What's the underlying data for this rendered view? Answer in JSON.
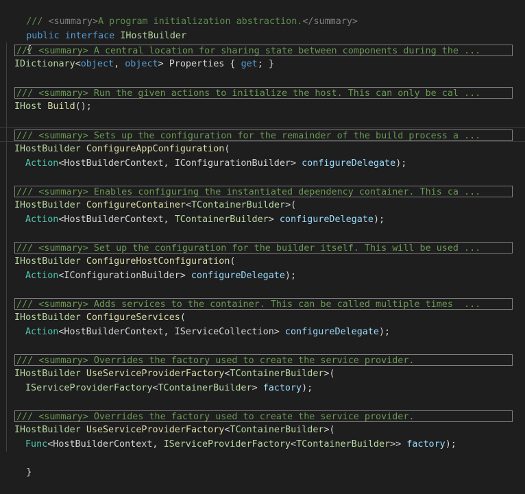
{
  "code": {
    "summary_comment": {
      "slashes": "///",
      "open_tag": "<summary>",
      "text": "A program initialization abstraction.",
      "close_tag": "</summary>"
    },
    "declaration": {
      "kw_public": "public",
      "kw_interface": "interface",
      "name": "IHostBuilder"
    },
    "open_brace": "{",
    "close_brace": "}",
    "members": [
      {
        "folded_comment": "/// <summary> A central location for sharing state between components during the ...",
        "lines": [
          {
            "parts": [
              {
                "t": "IDictionary",
                "c": "iface"
              },
              {
                "t": "<",
                "c": "punc"
              },
              {
                "t": "object",
                "c": "kw"
              },
              {
                "t": ", ",
                "c": "punc"
              },
              {
                "t": "object",
                "c": "kw"
              },
              {
                "t": "> Properties { ",
                "c": "punc"
              },
              {
                "t": "get",
                "c": "kw"
              },
              {
                "t": "; }",
                "c": "punc"
              }
            ]
          }
        ]
      },
      {
        "folded_comment": "/// <summary> Run the given actions to initialize the host. This can only be cal ...",
        "lines": [
          {
            "parts": [
              {
                "t": "IHost",
                "c": "iface"
              },
              {
                "t": " ",
                "c": "punc"
              },
              {
                "t": "Build",
                "c": "meth"
              },
              {
                "t": "();",
                "c": "punc"
              }
            ]
          }
        ]
      },
      {
        "folded_comment": "/// <summary> Sets up the configuration for the remainder of the build process a ...",
        "lines": [
          {
            "parts": [
              {
                "t": "IHostBuilder",
                "c": "iface"
              },
              {
                "t": " ",
                "c": "punc"
              },
              {
                "t": "ConfigureAppConfiguration",
                "c": "meth"
              },
              {
                "t": "(",
                "c": "punc"
              }
            ]
          },
          {
            "indent": true,
            "parts": [
              {
                "t": "Action",
                "c": "type"
              },
              {
                "t": "<HostBuilderContext, ",
                "c": "punc"
              },
              {
                "t": "IConfigurationBuilder",
                "c": "punc"
              },
              {
                "t": "> ",
                "c": "punc"
              },
              {
                "t": "configureDelegate",
                "c": "param"
              },
              {
                "t": ");",
                "c": "punc"
              }
            ]
          }
        ]
      },
      {
        "folded_comment": "/// <summary> Enables configuring the instantiated dependency container. This ca ...",
        "lines": [
          {
            "parts": [
              {
                "t": "IHostBuilder",
                "c": "iface"
              },
              {
                "t": " ",
                "c": "punc"
              },
              {
                "t": "ConfigureContainer",
                "c": "meth"
              },
              {
                "t": "<",
                "c": "punc"
              },
              {
                "t": "TContainerBuilder",
                "c": "iface"
              },
              {
                "t": ">(",
                "c": "punc"
              }
            ]
          },
          {
            "indent": true,
            "parts": [
              {
                "t": "Action",
                "c": "type"
              },
              {
                "t": "<HostBuilderContext, ",
                "c": "punc"
              },
              {
                "t": "TContainerBuilder",
                "c": "iface"
              },
              {
                "t": "> ",
                "c": "punc"
              },
              {
                "t": "configureDelegate",
                "c": "param"
              },
              {
                "t": ");",
                "c": "punc"
              }
            ]
          }
        ]
      },
      {
        "folded_comment": "/// <summary> Set up the configuration for the builder itself. This will be used ...",
        "lines": [
          {
            "parts": [
              {
                "t": "IHostBuilder",
                "c": "iface"
              },
              {
                "t": " ",
                "c": "punc"
              },
              {
                "t": "ConfigureHostConfiguration",
                "c": "meth"
              },
              {
                "t": "(",
                "c": "punc"
              }
            ]
          },
          {
            "indent": true,
            "parts": [
              {
                "t": "Action",
                "c": "type"
              },
              {
                "t": "<IConfigurationBuilder> ",
                "c": "punc"
              },
              {
                "t": "configureDelegate",
                "c": "param"
              },
              {
                "t": ");",
                "c": "punc"
              }
            ]
          }
        ]
      },
      {
        "folded_comment": "/// <summary> Adds services to the container. This can be called multiple times  ...",
        "lines": [
          {
            "parts": [
              {
                "t": "IHostBuilder",
                "c": "iface"
              },
              {
                "t": " ",
                "c": "punc"
              },
              {
                "t": "ConfigureServices",
                "c": "meth"
              },
              {
                "t": "(",
                "c": "punc"
              }
            ]
          },
          {
            "indent": true,
            "parts": [
              {
                "t": "Action",
                "c": "type"
              },
              {
                "t": "<HostBuilderContext, IServiceCollection> ",
                "c": "punc"
              },
              {
                "t": "configureDelegate",
                "c": "param"
              },
              {
                "t": ");",
                "c": "punc"
              }
            ]
          }
        ]
      },
      {
        "folded_comment": "/// <summary> Overrides the factory used to create the service provider.",
        "lines": [
          {
            "parts": [
              {
                "t": "IHostBuilder",
                "c": "iface"
              },
              {
                "t": " ",
                "c": "punc"
              },
              {
                "t": "UseServiceProviderFactory",
                "c": "meth"
              },
              {
                "t": "<",
                "c": "punc"
              },
              {
                "t": "TContainerBuilder",
                "c": "iface"
              },
              {
                "t": ">(",
                "c": "punc"
              }
            ]
          },
          {
            "indent": true,
            "parts": [
              {
                "t": "IServiceProviderFactory",
                "c": "iface"
              },
              {
                "t": "<",
                "c": "punc"
              },
              {
                "t": "TContainerBuilder",
                "c": "iface"
              },
              {
                "t": "> ",
                "c": "punc"
              },
              {
                "t": "factory",
                "c": "param"
              },
              {
                "t": ");",
                "c": "punc"
              }
            ]
          }
        ]
      },
      {
        "folded_comment": "/// <summary> Overrides the factory used to create the service provider.",
        "lines": [
          {
            "parts": [
              {
                "t": "IHostBuilder",
                "c": "iface"
              },
              {
                "t": " ",
                "c": "punc"
              },
              {
                "t": "UseServiceProviderFactory",
                "c": "meth"
              },
              {
                "t": "<",
                "c": "punc"
              },
              {
                "t": "TContainerBuilder",
                "c": "iface"
              },
              {
                "t": ">(",
                "c": "punc"
              }
            ]
          },
          {
            "indent": true,
            "parts": [
              {
                "t": "Func",
                "c": "type"
              },
              {
                "t": "<HostBuilderContext, ",
                "c": "punc"
              },
              {
                "t": "IServiceProviderFactory",
                "c": "iface"
              },
              {
                "t": "<",
                "c": "punc"
              },
              {
                "t": "TContainerBuilder",
                "c": "iface"
              },
              {
                "t": ">> ",
                "c": "punc"
              },
              {
                "t": "factory",
                "c": "param"
              },
              {
                "t": ");",
                "c": "punc"
              }
            ]
          }
        ]
      }
    ]
  },
  "colors": {
    "background": "#1e1e1e",
    "keyword": "#569cd6",
    "type": "#4ec9b0",
    "interface": "#b8d7a3",
    "method": "#dcdcaa",
    "parameter": "#9cdcfe",
    "comment": "#608b4e",
    "xml_doc_tag": "#808080",
    "text": "#d4d4d4"
  }
}
